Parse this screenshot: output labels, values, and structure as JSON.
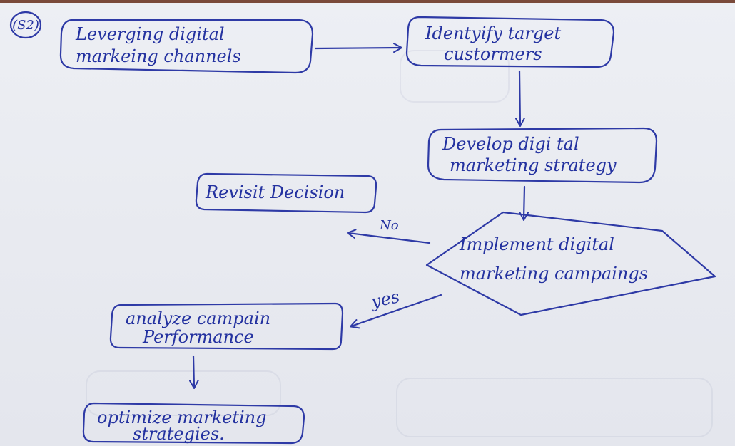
{
  "question_mark": "(S2)",
  "nodes": {
    "leveraging": {
      "line1": "Leverging digital",
      "line2": "markeing channels"
    },
    "identify": {
      "line1": "Identyify target",
      "line2": "custormers"
    },
    "develop": {
      "line1": "Develop digi tal",
      "line2": "marketing strategy"
    },
    "revisit": {
      "line1": "Revisit Decision"
    },
    "implement": {
      "line1": "Implement digital",
      "line2": "marketing campaings"
    },
    "analyze": {
      "line1": "analyze campain",
      "line2": "Performance"
    },
    "optimize": {
      "line1": "optimize marketing",
      "line2": "strategies."
    }
  },
  "edge_labels": {
    "no": "No",
    "yes": "yes"
  },
  "colors": {
    "ink": "#2432a0",
    "paper": "#e9ebf1"
  }
}
